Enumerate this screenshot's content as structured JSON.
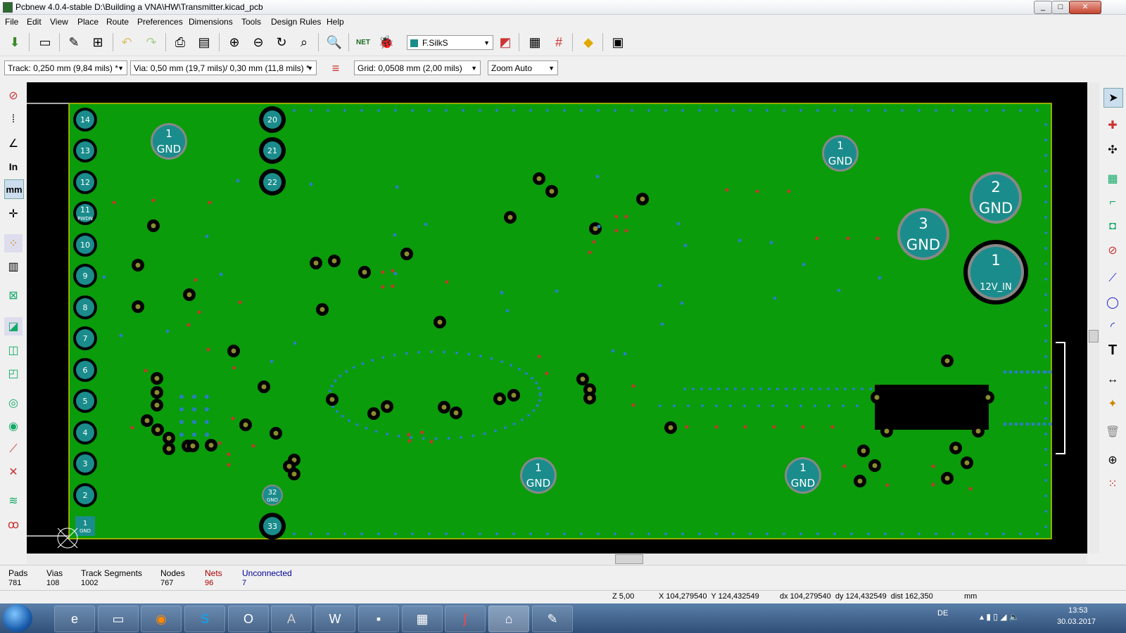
{
  "window": {
    "title": "Pcbnew 4.0.4-stable D:\\Building a VNA\\HW\\Transmitter.kicad_pcb",
    "btn_min": "_",
    "btn_max": "□",
    "btn_close": "✕"
  },
  "menu": [
    "File",
    "Edit",
    "View",
    "Place",
    "Route",
    "Preferences",
    "Dimensions",
    "Tools",
    "Design Rules",
    "Help"
  ],
  "toolbar": {
    "net_label": "NET",
    "layer_select": "F.SilkS"
  },
  "toolbar2": {
    "track": "Track: 0,250 mm (9,84 mils) *",
    "via": "Via: 0,50 mm (19,7 mils)/ 0,30 mm (11,8 mils) *",
    "grid": "Grid: 0,0508 mm (2,00 mils)",
    "zoom": "Zoom Auto"
  },
  "left_tools": {
    "inch_label": "In",
    "mm_label": "mm"
  },
  "pcb": {
    "edge_pads": [
      "14",
      "13",
      "12",
      "11",
      "10",
      "9",
      "8",
      "7",
      "6",
      "5",
      "4",
      "3",
      "2",
      "1"
    ],
    "edge_pad_sub": {
      "pad1": "GND",
      "pad11": "PWDN"
    },
    "mid_pads": [
      "20",
      "21",
      "22"
    ],
    "pad32": {
      "num": "32",
      "net": "GND"
    },
    "pad33": {
      "num": "33"
    },
    "big_pads": [
      {
        "num": "1",
        "net": "GND"
      },
      {
        "num": "1",
        "net": "GND"
      },
      {
        "num": "2",
        "net": "GND"
      },
      {
        "num": "3",
        "net": "GND"
      },
      {
        "num": "1",
        "net": "12V_IN"
      },
      {
        "num": "1",
        "net": "GND"
      },
      {
        "num": "1",
        "net": "GND"
      }
    ],
    "colors": {
      "copper": "#0a9c0a",
      "pad": "#1b8c8c",
      "via_ring": "#000000",
      "background": "#000000"
    }
  },
  "status": {
    "labels": [
      "Pads",
      "Vias",
      "Track Segments",
      "Nodes",
      "Nets",
      "Unconnected"
    ],
    "values": [
      "781",
      "108",
      "1002",
      "767",
      "96",
      "7"
    ],
    "zoom": "Z 5,00",
    "xy": "X 104,279540  Y 124,432549",
    "dxy": "dx 104,279540  dy 124,432549  dist 162,350",
    "units": "mm"
  },
  "taskbar": {
    "lang": "DE",
    "time": "13:53",
    "date": "30.03.2017"
  }
}
